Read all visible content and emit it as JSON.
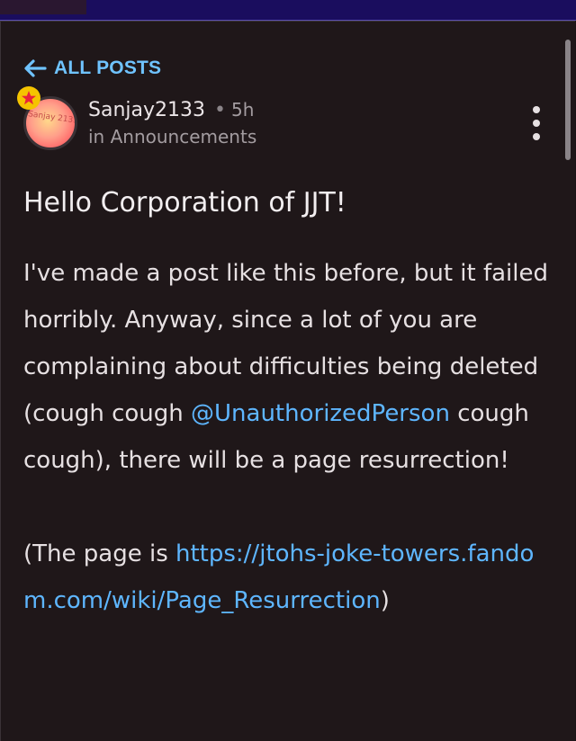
{
  "nav": {
    "back_label": "ALL POSTS"
  },
  "post": {
    "avatar_text": "Sanjay 2133",
    "author": "Sanjay2133",
    "separator": "•",
    "time": "5h",
    "category": "in Announcements",
    "title": "Hello Corporation of JJT!",
    "p1_text_a": "I've made a post like this before, but it failed horribly. Anyway, since a lot of you are complaining about difficulties being deleted (cough cough ",
    "mention": "@UnauthorizedPerson",
    "p1_text_b": " cough cough), there will be a page resurrection!",
    "p2_text_a": "(The page is ",
    "page_link": "https://jtohs-joke-towers.fandom.com/wiki/Page_Resurrection",
    "p2_text_b": ")"
  },
  "colors": {
    "accent": "#6fc3ff",
    "link": "#5eb6ff",
    "background": "#1f1719",
    "badge": "#f5c400"
  },
  "icons": [
    "arrow-left-icon",
    "star-badge-icon",
    "more-options-icon"
  ]
}
